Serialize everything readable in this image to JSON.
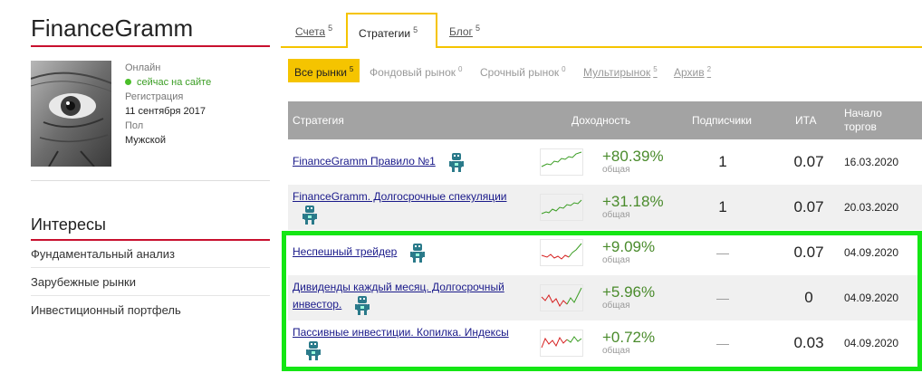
{
  "profile": {
    "name": "FinanceGramm",
    "status_label": "Онлайн",
    "status_value": "сейчас на сайте",
    "reg_label": "Регистрация",
    "reg_value": "11 сентября 2017",
    "gender_label": "Пол",
    "gender_value": "Мужской"
  },
  "interests": {
    "title": "Интересы",
    "items": [
      "Фундаментальный анализ",
      "Зарубежные рынки",
      "Инвестиционный портфель"
    ]
  },
  "tabs": [
    {
      "label": "Счета",
      "count": "5"
    },
    {
      "label": "Стратегии",
      "count": "5"
    },
    {
      "label": "Блог",
      "count": "5"
    }
  ],
  "filters": [
    {
      "label": "Все рынки",
      "count": "5"
    },
    {
      "label": "Фондовый рынок",
      "count": "0"
    },
    {
      "label": "Срочный рынок",
      "count": "0"
    },
    {
      "label": "Мультирынок",
      "count": "5"
    },
    {
      "label": "Архив",
      "count": "2"
    }
  ],
  "table": {
    "headers": {
      "strategy": "Стратегия",
      "yield": "Доходность",
      "subscribers": "Подписчики",
      "ita": "ИТА",
      "start": "Начало торгов"
    },
    "yield_sub": "общая",
    "rows": [
      {
        "name": "FinanceGramm Правило №1",
        "yield": "+80.39%",
        "subscribers": "1",
        "ita": "0.07",
        "start": "16.03.2020",
        "spark_color": "#3a9d23"
      },
      {
        "name": "FinanceGramm. Долгосрочные спекуляции",
        "yield": "+31.18%",
        "subscribers": "1",
        "ita": "0.07",
        "start": "20.03.2020",
        "spark_color": "#3a9d23"
      },
      {
        "name": "Неспешный трейдер",
        "yield": "+9.09%",
        "subscribers": "—",
        "ita": "0.07",
        "start": "04.09.2020",
        "spark_color": "#3a9d23"
      },
      {
        "name": "Дивиденды каждый месяц. Долгосрочный инвестор.",
        "yield": "+5.96%",
        "subscribers": "—",
        "ita": "0",
        "start": "04.09.2020",
        "spark_color": "#3a9d23"
      },
      {
        "name": "Пассивные инвестиции. Копилка. Индексы",
        "yield": "+0.72%",
        "subscribers": "—",
        "ita": "0.03",
        "start": "04.09.2020",
        "spark_color": "#3a9d23"
      }
    ]
  },
  "colors": {
    "accent": "#f5c400",
    "brand_red": "#c8102e",
    "highlight": "#14e614",
    "positive": "#4a8b2c",
    "negative": "#d62020"
  },
  "icons": {
    "robot": "robot-icon",
    "online": "online-dot-icon"
  }
}
